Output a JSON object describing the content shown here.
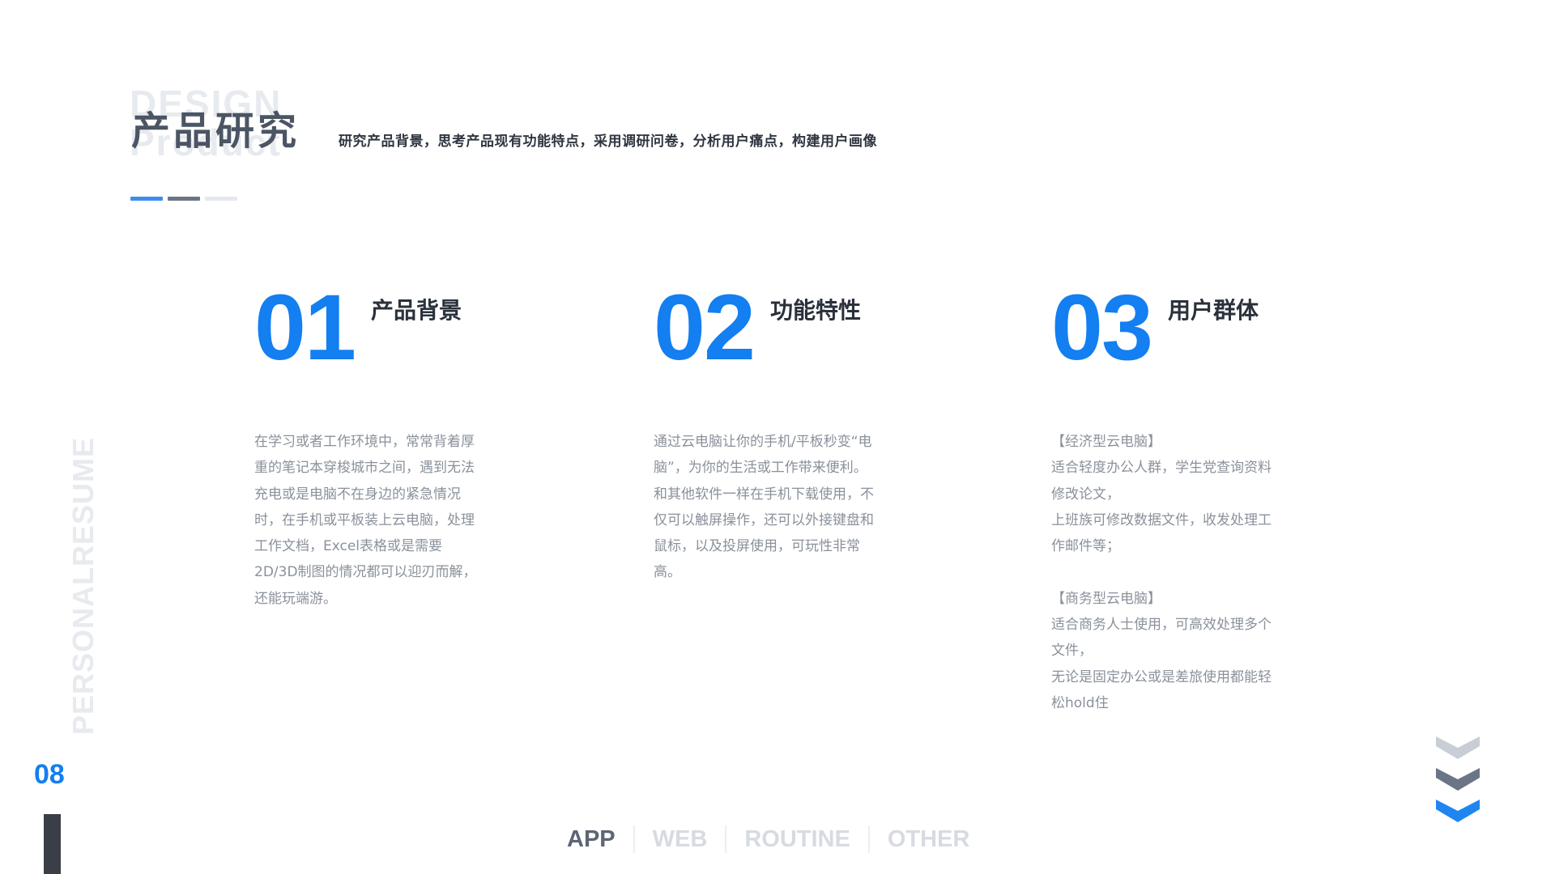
{
  "header": {
    "ghost_text": "DESIGN\nProduct",
    "title": "产品研究",
    "subtitle": "研究产品背景，思考产品现有功能特点，采用调研问卷，分析用户痛点，构建用户画像"
  },
  "sections": [
    {
      "number": "01",
      "title": "产品背景",
      "paragraphs": [
        "在学习或者工作环境中，常常背着厚重的笔记本穿梭城市之间，遇到无法充电或是电脑不在身边的紧急情况时，在手机或平板装上云电脑，处理工作文档，Excel表格或是需要2D/3D制图的情况都可以迎刃而解，还能玩端游。"
      ]
    },
    {
      "number": "02",
      "title": "功能特性",
      "paragraphs": [
        "通过云电脑让你的手机/平板秒变“电脑”，为你的生活或工作带来便利。和其他软件一样在手机下载使用，不仅可以触屏操作，还可以外接键盘和鼠标，以及投屏使用，可玩性非常高。"
      ]
    },
    {
      "number": "03",
      "title": "用户群体",
      "paragraphs": [
        "【经济型云电脑】\n适合轻度办公人群，学生党查询资料修改论文，\n上班族可修改数据文件，收发处理工作邮件等；\n\n【商务型云电脑】\n适合商务人士使用，可高效处理多个文件，\n无论是固定办公或是差旅使用都能轻松hold住"
      ]
    }
  ],
  "side": {
    "vertical_text": "PERSONALRESUME",
    "page_number": "08"
  },
  "nav": {
    "items": [
      "APP",
      "WEB",
      "ROUTINE",
      "OTHER"
    ],
    "active_index": 0
  },
  "colors": {
    "accent_blue": "#137ff0",
    "dark_text": "#2a313b",
    "body_text": "#8a919b",
    "chevron_light": "#c8ced6",
    "chevron_mid": "#6b7585",
    "chevron_blue": "#1f86f1"
  },
  "icons": [
    "chevron-down-icon",
    "chevron-down-icon",
    "chevron-down-icon"
  ]
}
